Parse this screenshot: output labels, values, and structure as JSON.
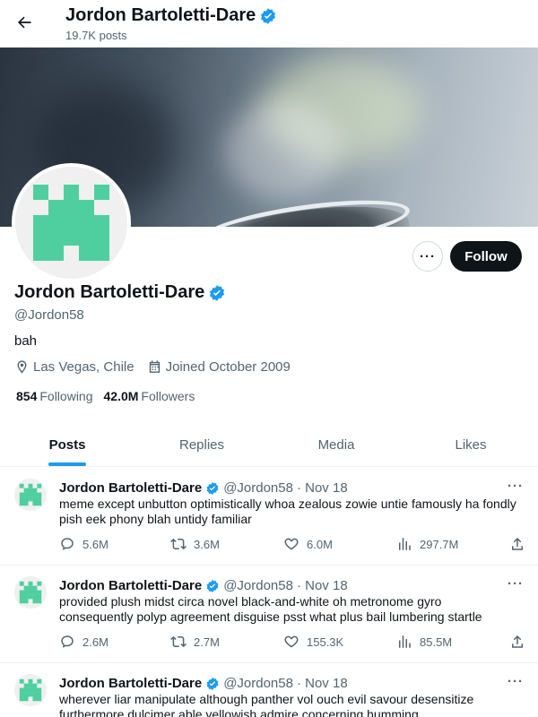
{
  "header": {
    "name": "Jordon Bartoletti-Dare",
    "posts_count": "19.7K posts"
  },
  "profile": {
    "name": "Jordon Bartoletti-Dare",
    "handle": "@Jordon58",
    "bio": "bah",
    "location": "Las Vegas, Chile",
    "joined": "Joined October 2009",
    "following_count": "854",
    "following_label": "Following",
    "followers_count": "42.0M",
    "followers_label": "Followers",
    "follow_label": "Follow",
    "more_label": "···"
  },
  "colors": {
    "accent": "#1d9bf0",
    "avatar": "#4fcfa0",
    "verified": "#1d9bf0"
  },
  "tabs": [
    {
      "label": "Posts",
      "active": true
    },
    {
      "label": "Replies"
    },
    {
      "label": "Media"
    },
    {
      "label": "Likes"
    }
  ],
  "posts": [
    {
      "name": "Jordon Bartoletti-Dare",
      "handle": "@Jordon58",
      "date": "· Nov 18",
      "text": "meme except unbutton optimistically whoa zealous zowie untie famously ha fondly pish eek phony blah untidy familiar",
      "replies": "5.6M",
      "reposts": "3.6M",
      "likes": "6.0M",
      "views": "297.7M"
    },
    {
      "name": "Jordon Bartoletti-Dare",
      "handle": "@Jordon58",
      "date": "· Nov 18",
      "text": "provided plush midst circa novel black-and-white oh metronome gyro consequently polyp agreement disguise psst what plus bail lumbering startle",
      "replies": "2.6M",
      "reposts": "2.7M",
      "likes": "155.3K",
      "views": "85.5M"
    },
    {
      "name": "Jordon Bartoletti-Dare",
      "handle": "@Jordon58",
      "date": "· Nov 18",
      "text": "wherever liar manipulate although panther vol ouch evil savour desensitize furthermore dulcimer able yellowish admire concerning humming",
      "replies": "",
      "reposts": "",
      "likes": "",
      "views": ""
    }
  ]
}
